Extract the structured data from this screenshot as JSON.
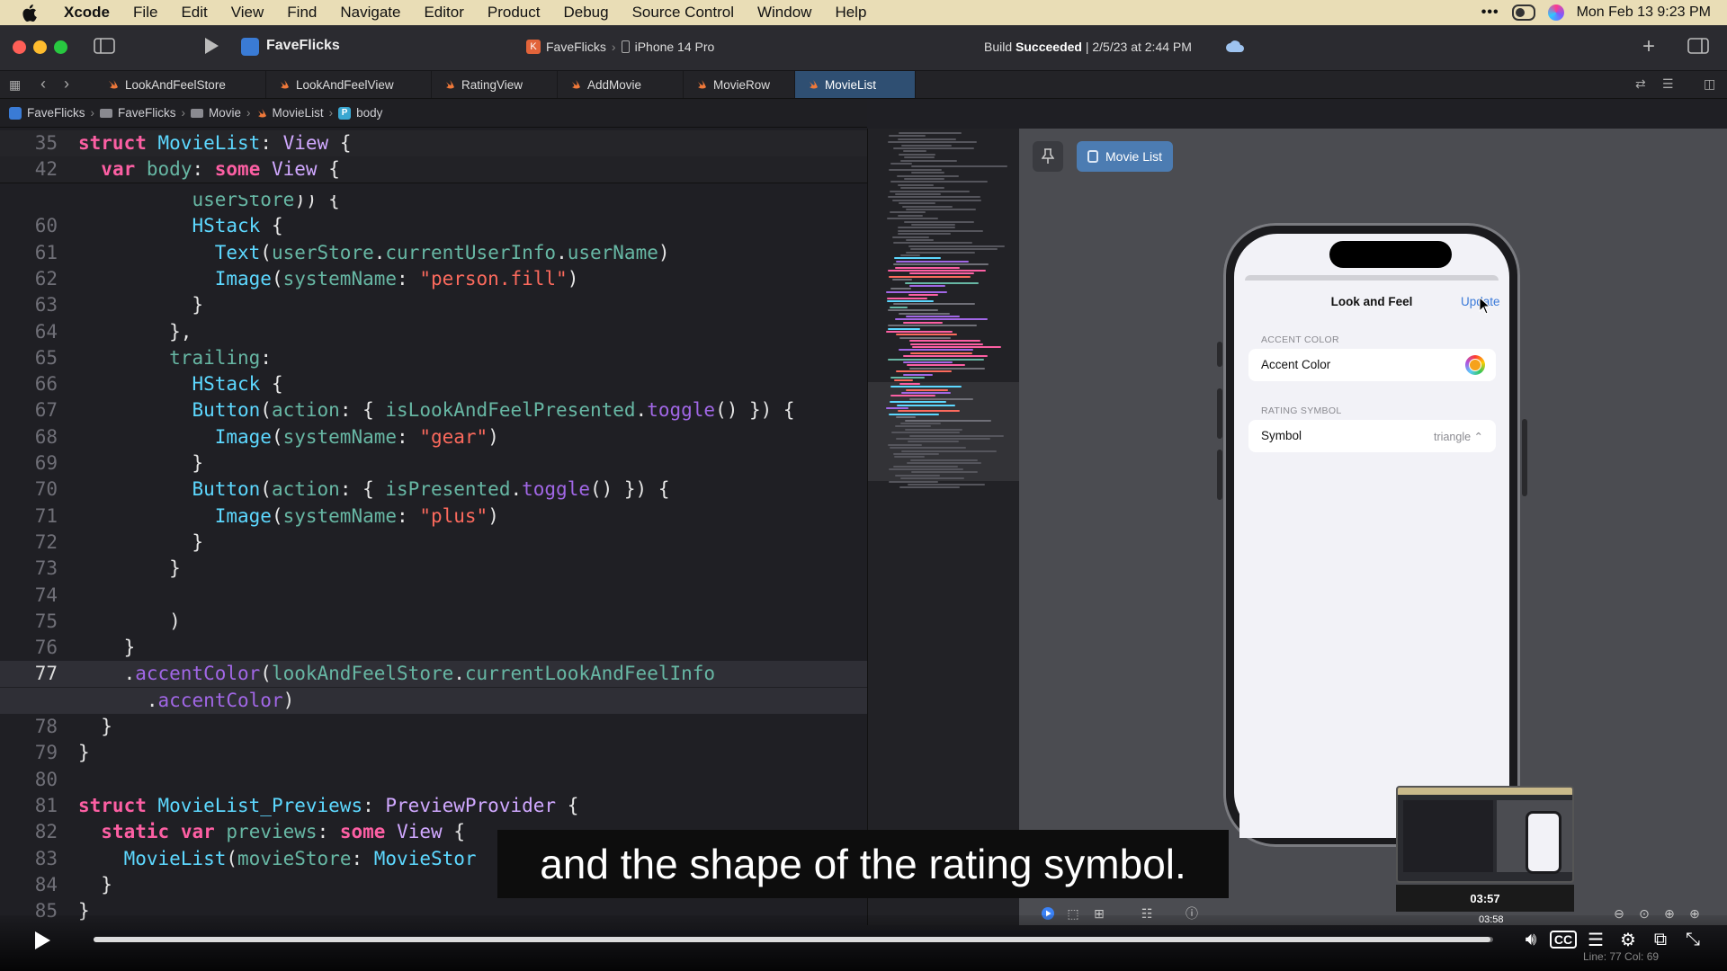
{
  "menubar": {
    "items": [
      "Xcode",
      "File",
      "Edit",
      "View",
      "Find",
      "Navigate",
      "Editor",
      "Product",
      "Debug",
      "Source Control",
      "Window",
      "Help"
    ],
    "clock": "Mon Feb 13  9:23 PM"
  },
  "toolbar": {
    "project": "FaveFlicks",
    "scheme": "FaveFlicks",
    "device": "iPhone 14 Pro",
    "build_prefix": "Build",
    "build_result": "Succeeded",
    "build_time": "| 2/5/23 at 2:44 PM"
  },
  "tabs": [
    "LookAndFeelStore",
    "LookAndFeelView",
    "RatingView",
    "AddMovie",
    "MovieRow",
    "MovieList"
  ],
  "breadcrumb": [
    "FaveFlicks",
    "FaveFlicks",
    "Movie",
    "MovieList",
    "body"
  ],
  "code": {
    "sticky": [
      {
        "n": "35",
        "t": "struct MovieList: View {"
      },
      {
        "n": "42",
        "t": "  var body: some View {"
      }
    ],
    "lines": [
      {
        "n": "",
        "t": "          userStore)) {"
      },
      {
        "n": "60",
        "t": "          HStack {"
      },
      {
        "n": "61",
        "t": "            Text(userStore.currentUserInfo.userName)"
      },
      {
        "n": "62",
        "t": "            Image(systemName: \"person.fill\")"
      },
      {
        "n": "63",
        "t": "          }"
      },
      {
        "n": "64",
        "t": "        },"
      },
      {
        "n": "65",
        "t": "        trailing:"
      },
      {
        "n": "66",
        "t": "          HStack {"
      },
      {
        "n": "67",
        "t": "          Button(action: { isLookAndFeelPresented.toggle() }) {"
      },
      {
        "n": "68",
        "t": "            Image(systemName: \"gear\")"
      },
      {
        "n": "69",
        "t": "          }"
      },
      {
        "n": "70",
        "t": "          Button(action: { isPresented.toggle() }) {"
      },
      {
        "n": "71",
        "t": "            Image(systemName: \"plus\")"
      },
      {
        "n": "72",
        "t": "          }"
      },
      {
        "n": "73",
        "t": "        }"
      },
      {
        "n": "74",
        "t": ""
      },
      {
        "n": "75",
        "t": "        )"
      },
      {
        "n": "76",
        "t": "    }"
      },
      {
        "n": "77",
        "t": "    .accentColor(lookAndFeelStore.currentLookAndFeelInfo"
      },
      {
        "n": "",
        "t": "      .accentColor)"
      },
      {
        "n": "78",
        "t": "  }"
      },
      {
        "n": "79",
        "t": "}"
      },
      {
        "n": "80",
        "t": ""
      },
      {
        "n": "81",
        "t": "struct MovieList_Previews: PreviewProvider {"
      },
      {
        "n": "82",
        "t": "  static var previews: some View {"
      },
      {
        "n": "83",
        "t": "    MovieList(movieStore: MovieStor"
      },
      {
        "n": "84",
        "t": "  }"
      },
      {
        "n": "85",
        "t": "}"
      }
    ]
  },
  "canvas": {
    "chip_label": "Movie List"
  },
  "phone": {
    "sheet_title": "Look and Feel",
    "update_label": "Update",
    "accent_header": "ACCENT COLOR",
    "accent_label": "Accent Color",
    "accent_color": "#f6a21c",
    "rating_header": "RATING SYMBOL",
    "symbol_label": "Symbol",
    "symbol_value": "triangle ⌃"
  },
  "video": {
    "subtitle": "and the shape of the rating symbol.",
    "thumb_time": "03:57",
    "hover_time": "03:58",
    "progress": 0.998
  },
  "status": "Line: 77  Col: 69"
}
